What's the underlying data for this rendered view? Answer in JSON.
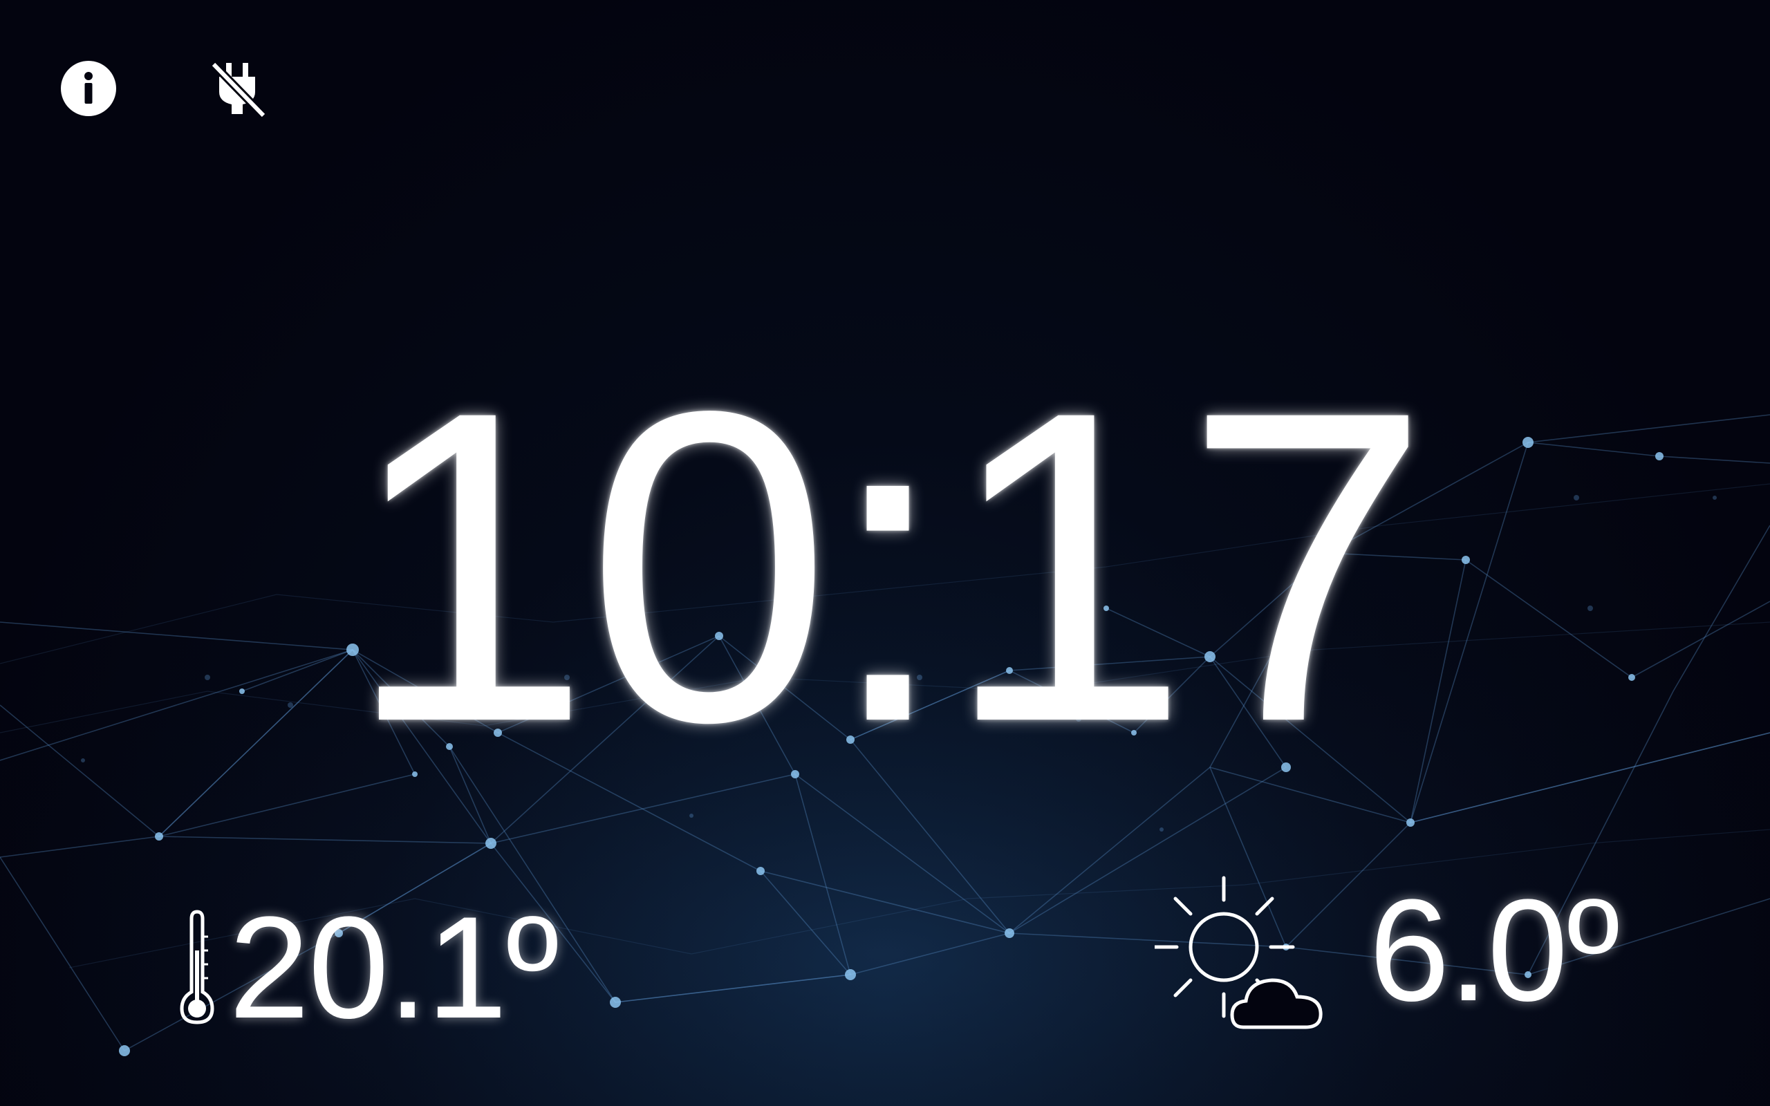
{
  "status_bar": {
    "info_icon": "info-icon",
    "charging_icon": "power-plug-off-icon"
  },
  "clock": {
    "time": "10:17"
  },
  "indoor": {
    "icon": "thermometer-icon",
    "temperature": "20.1º"
  },
  "outdoor": {
    "icon": "partly-cloudy-icon",
    "temperature": "6.0º"
  },
  "colors": {
    "background": "#03040f",
    "network_lines": "#5a8fc8",
    "text": "#ffffff"
  }
}
